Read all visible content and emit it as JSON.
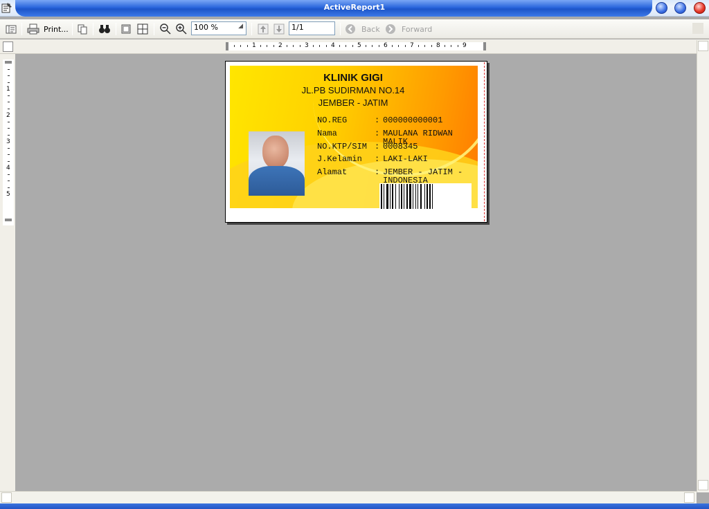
{
  "window": {
    "title": "ActiveReport1"
  },
  "toolbar": {
    "print_label": "Print...",
    "zoom_value": "100 %",
    "page_value": "1/1",
    "back_label": "Back",
    "forward_label": "Forward"
  },
  "ruler": {
    "h_ticks": [
      "1",
      "2",
      "3",
      "4",
      "5",
      "6",
      "7",
      "8",
      "9"
    ],
    "v_ticks": [
      "1",
      "2",
      "3",
      "4",
      "5"
    ]
  },
  "card": {
    "clinic_name": "KLINIK GIGI",
    "address": "JL.PB SUDIRMAN  NO.14",
    "city": "JEMBER - JATIM",
    "fields": [
      {
        "label": "NO.REG",
        "value": "000000000001"
      },
      {
        "label": "Nama",
        "value": "MAULANA RIDWAN MALIK"
      },
      {
        "label": "NO.KTP/SIM",
        "value": "0008345"
      },
      {
        "label": "J.Kelamin",
        "value": "LAKI-LAKI"
      },
      {
        "label": "Alamat",
        "value": "JEMBER - JATIM - INDONESIA"
      }
    ],
    "colon": ":"
  },
  "colors": {
    "title_bar": "#2a66dc",
    "card_yellow": "#ffe600",
    "card_orange": "#ff7a00"
  }
}
